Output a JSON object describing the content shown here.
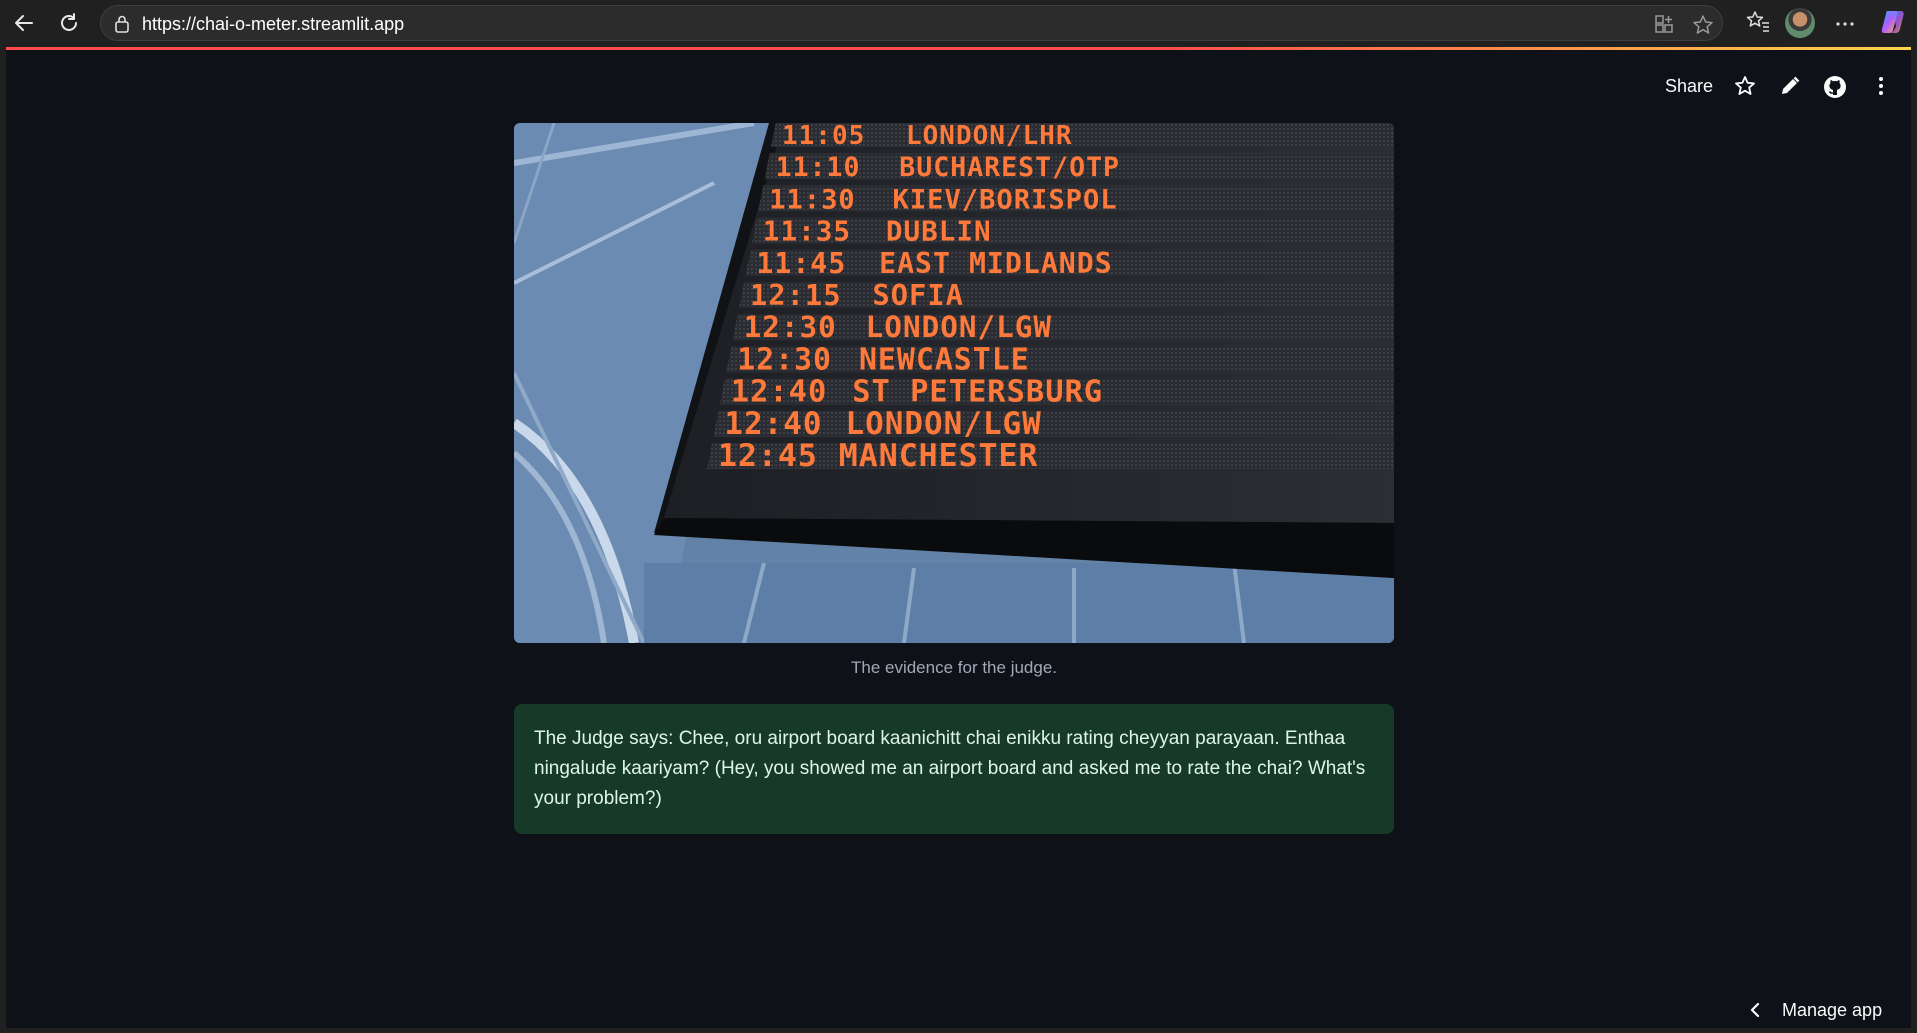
{
  "browser": {
    "url": "https://chai-o-meter.streamlit.app",
    "icons": [
      "back-icon",
      "reload-icon",
      "lock-icon",
      "app-available-icon",
      "favorite-star-icon",
      "favorites-list-icon",
      "profile-avatar",
      "more-icon",
      "copilot-icon"
    ]
  },
  "app_toolbar": {
    "share_label": "Share",
    "icons": [
      "star-icon",
      "edit-pencil-icon",
      "github-icon",
      "kebab-menu-icon"
    ]
  },
  "evidence": {
    "caption": "The evidence for the judge.",
    "board_rows": [
      {
        "time": "11:05",
        "destination": "LONDON/LHR"
      },
      {
        "time": "11:10",
        "destination": "BUCHAREST/OTP"
      },
      {
        "time": "11:30",
        "destination": "KIEV/BORISPOL"
      },
      {
        "time": "11:35",
        "destination": "DUBLIN"
      },
      {
        "time": "11:45",
        "destination": "EAST MIDLANDS"
      },
      {
        "time": "12:15",
        "destination": "SOFIA"
      },
      {
        "time": "12:30",
        "destination": "LONDON/LGW"
      },
      {
        "time": "12:30",
        "destination": "NEWCASTLE"
      },
      {
        "time": "12:40",
        "destination": "ST PETERSBURG"
      },
      {
        "time": "12:40",
        "destination": "LONDON/LGW"
      },
      {
        "time": "12:45",
        "destination": "MANCHESTER"
      }
    ]
  },
  "verdict": {
    "text": "The Judge says: Chee, oru airport board kaanichitt chai enikku rating cheyyan parayaan. Enthaa ningalude kaariyam? (Hey, you showed me an airport board and asked me to rate the chai? What's your problem?)"
  },
  "footer": {
    "manage_label": "Manage app"
  },
  "colors": {
    "app_background": "#0e1117",
    "chrome_background": "#202020",
    "success_box": "#173928",
    "success_text": "#dff5e5",
    "led_orange": "#ff7a3a"
  }
}
